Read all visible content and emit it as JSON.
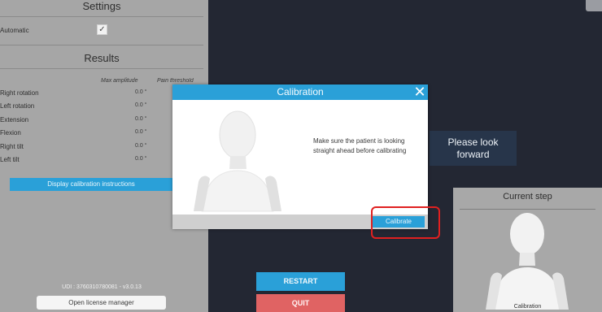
{
  "settings": {
    "title": "Settings",
    "automatic_label": "Automatic",
    "automatic_checked_glyph": "✓"
  },
  "results": {
    "title": "Results",
    "col_max": "Max amplitude",
    "col_pain": "Pain threshold",
    "rows": [
      {
        "label": "Right rotation",
        "value": "0.0 °"
      },
      {
        "label": "Left rotation",
        "value": "0.0 °"
      },
      {
        "label": "Extension",
        "value": "0.0 °"
      },
      {
        "label": "Flexion",
        "value": "0.0 °"
      },
      {
        "label": "Right tilt",
        "value": "0.0 °"
      },
      {
        "label": "Left tilt",
        "value": "0.0 °"
      }
    ],
    "calibration_instructions_button": "Display calibration instructions"
  },
  "footer_left": {
    "udi": "UDI : 3760310780081 - v3.0.13",
    "license_button": "Open license manager"
  },
  "prompt": {
    "text_line1": "Please look",
    "text_line2": "forward"
  },
  "current_step": {
    "title": "Current step",
    "caption": "Calibration"
  },
  "controls": {
    "restart": "RESTART",
    "quit": "QUIT"
  },
  "modal": {
    "title": "Calibration",
    "close_glyph": "✕",
    "message": "Make sure the patient is looking straight ahead before calibrating",
    "calibrate_button": "Calibrate"
  },
  "colors": {
    "accent_blue": "#2aa0d8",
    "quit_red": "#e06363",
    "highlight_red": "#e02020",
    "background": "#232733"
  }
}
